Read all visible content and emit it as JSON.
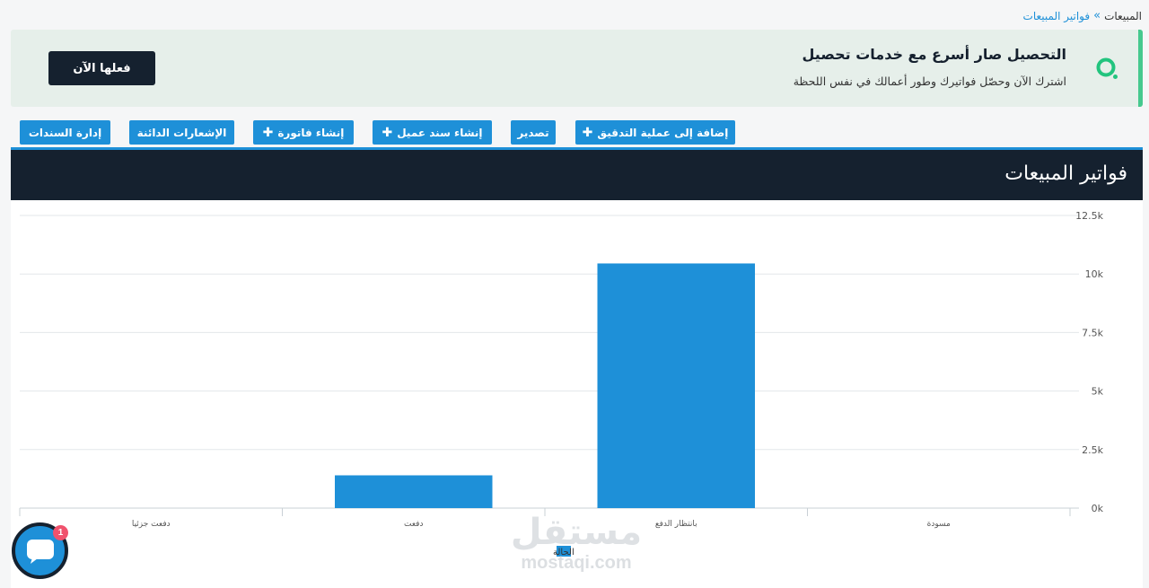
{
  "breadcrumb": {
    "parent": "المبيعات",
    "separator": "»",
    "current": "فواتير المبيعات"
  },
  "promo": {
    "title": "التحصيل صار أسرع مع خدمات تحصيل",
    "text": "اشترك الآن وحصّل فواتيرك وطور أعمالك في نفس اللحظة",
    "button_label": "فعلها الآن",
    "icon": "brand-o-icon",
    "accent_color": "#46c98e"
  },
  "toolbar": {
    "buttons": [
      {
        "label": "إضافة إلى عملية التدقيق",
        "icon": "plus-icon"
      },
      {
        "label": "تصدير"
      },
      {
        "label": "إنشاء سند عميل",
        "icon": "plus-icon"
      },
      {
        "label": "إنشاء فاتورة",
        "icon": "plus-icon"
      },
      {
        "label": "الإشعارات الدائنة"
      },
      {
        "label": "إدارة السندات"
      }
    ]
  },
  "panel": {
    "title": "فواتير المبيعات"
  },
  "chart_data": {
    "type": "bar",
    "categories": [
      "دفعت جزئيا",
      "دفعت",
      "بانتظار الدفع",
      "مسودة"
    ],
    "series": [
      {
        "name": "الحالة",
        "values": [
          0,
          1400,
          10450,
          0
        ]
      }
    ],
    "ylim": [
      0,
      12500
    ],
    "yticks": [
      0,
      2500,
      5000,
      7500,
      10000,
      12500
    ],
    "ytick_labels": [
      "0k",
      "2.5k",
      "5k",
      "7.5k",
      "10k",
      "12.5k"
    ],
    "bar_color": "#1e90d8",
    "grid": true,
    "legend": "bottom"
  },
  "watermark": {
    "arabic": "مستقل",
    "latin": "mostaqi.com"
  },
  "chat": {
    "badge_count": "1",
    "icon": "chat-bubble-icon"
  },
  "colors": {
    "primary": "#1e90d8",
    "dark": "#15212f",
    "banner_bg": "#e6efea"
  }
}
